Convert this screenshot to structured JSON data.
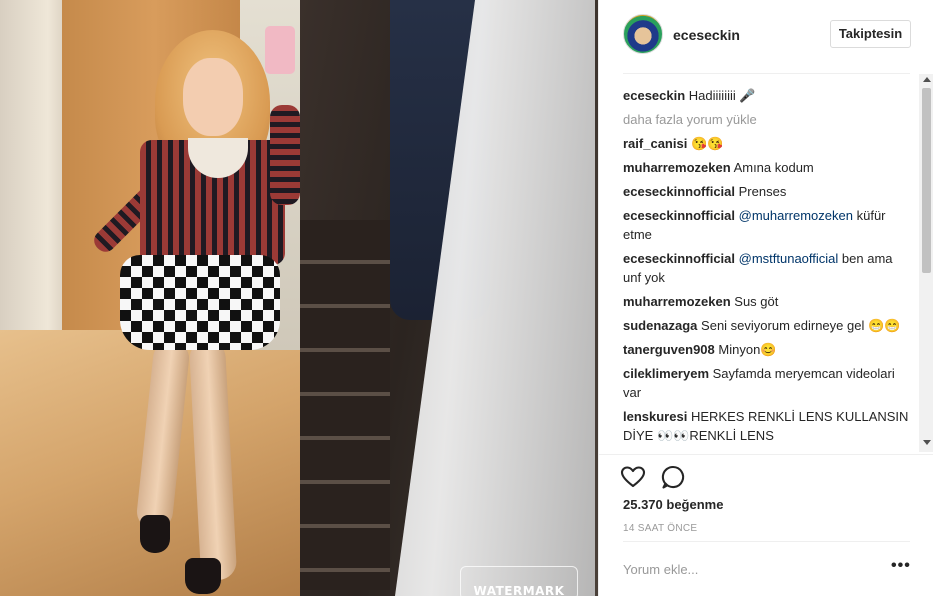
{
  "header": {
    "username": "eceseckin",
    "follow_label": "Takiptesin",
    "avatar_icon": "profile-avatar-icon"
  },
  "comments": {
    "load_more": "daha fazla yorum yükle",
    "items": [
      {
        "user": "eceseckin",
        "text": "Hadiiiiiiii 🎤"
      },
      {
        "user": "raif_canisi",
        "text": "😘😘"
      },
      {
        "user": "muharremozeken",
        "text": "Amına kodum"
      },
      {
        "user": "eceseckinnofficial",
        "text": "Prenses"
      },
      {
        "user": "eceseckinnofficial",
        "mention": "@muharremozeken",
        "text": "küfür etme"
      },
      {
        "user": "eceseckinnofficial",
        "mention": "@mstftunaofficial",
        "text": "ben ama unf yok"
      },
      {
        "user": "muharremozeken",
        "text": "Sus göt"
      },
      {
        "user": "sudenazaga",
        "text": "Seni seviyorum edirneye gel 😁😁"
      },
      {
        "user": "tanerguven908",
        "text": "Minyon😊"
      },
      {
        "user": "cileklimeryem",
        "text": "Sayfamda meryemcan videolari var"
      },
      {
        "user": "lenskuresi",
        "text": "HERKES RENKLİ LENS KULLANSIN DİYE 👀👀RENKLİ LENS"
      }
    ]
  },
  "actions": {
    "like_icon": "heart-icon",
    "comment_icon": "comment-bubble-icon",
    "likes": "25.370 beğenme",
    "timestamp": "14 SAAT ÖNCE",
    "comment_placeholder": "Yorum ekle...",
    "more_label": "•••"
  },
  "photo": {
    "watermark": "WATERMARK"
  }
}
